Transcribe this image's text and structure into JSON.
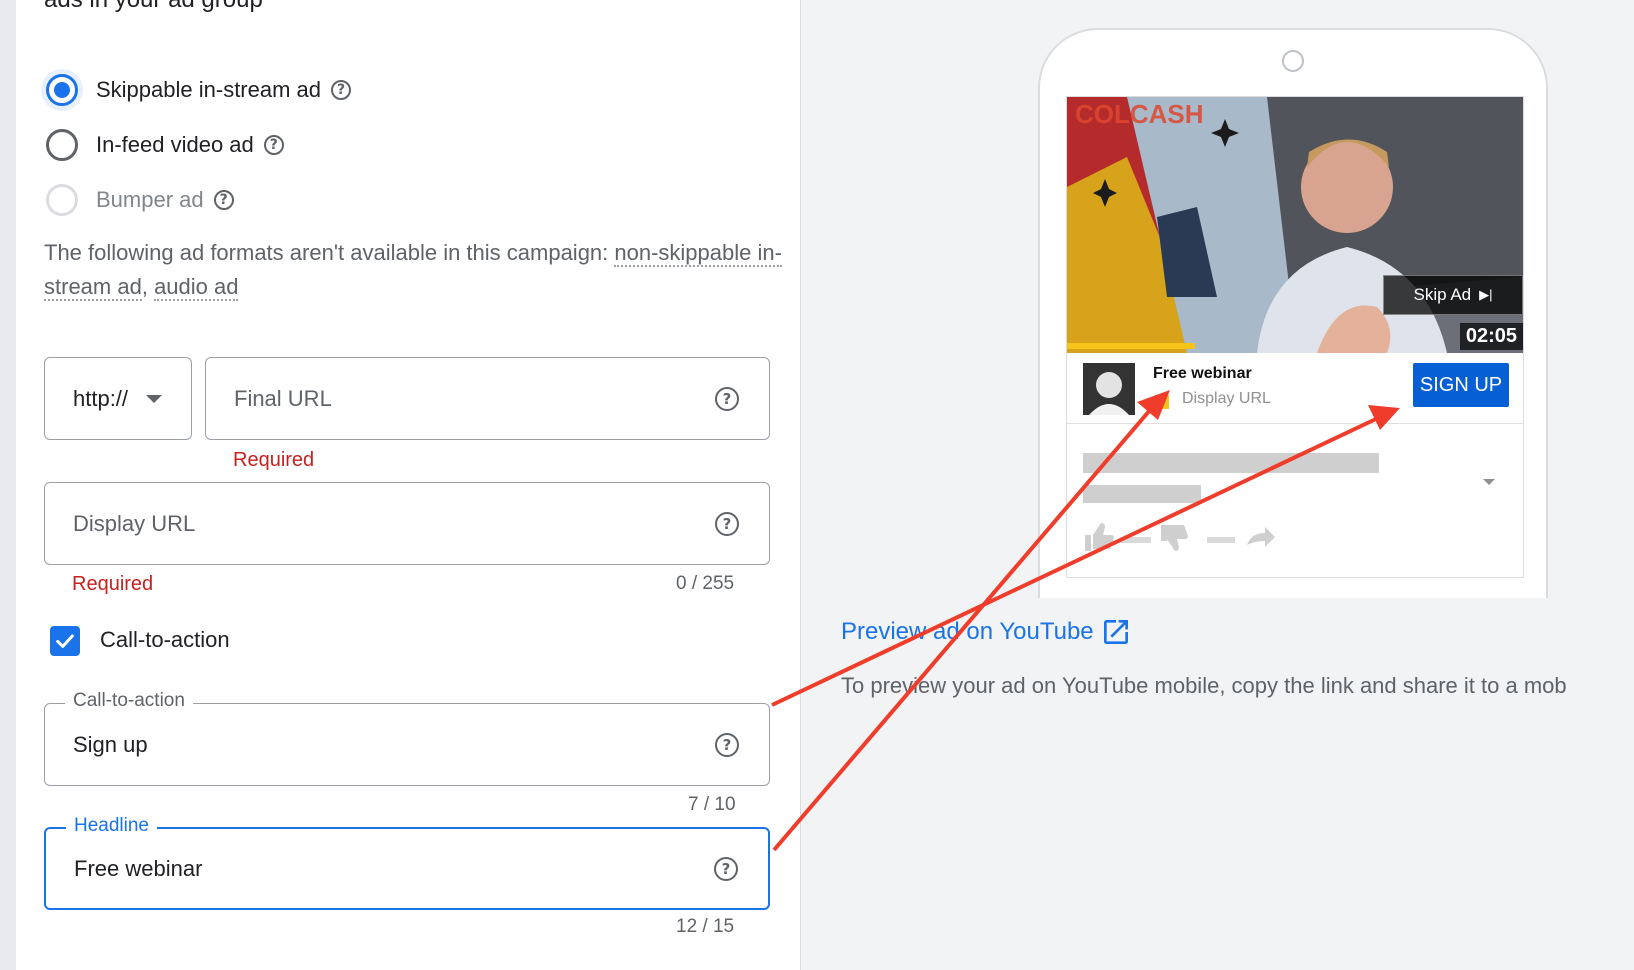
{
  "section": {
    "title": "ads in your ad group"
  },
  "ad_formats": [
    {
      "label": "Skippable in-stream ad",
      "selected": true,
      "disabled": false
    },
    {
      "label": "In-feed video ad",
      "selected": false,
      "disabled": false
    },
    {
      "label": "Bumper ad",
      "selected": false,
      "disabled": true
    }
  ],
  "unavailable_note": {
    "text": "The following ad formats aren't available in this campaign: ",
    "link1": "non-skippable in-stream ad",
    "separator": ", ",
    "link2": "audio ad"
  },
  "protocol_select": {
    "value": "http://"
  },
  "final_url": {
    "placeholder": "Final URL",
    "error": "Required"
  },
  "display_url": {
    "placeholder": "Display URL",
    "error": "Required",
    "counter": "0 / 255"
  },
  "cta_checkbox": {
    "label": "Call-to-action",
    "checked": true
  },
  "cta_field": {
    "label": "Call-to-action",
    "value": "Sign up",
    "counter": "7 / 10"
  },
  "headline_field": {
    "label": "Headline",
    "value": "Free webinar",
    "counter": "12 / 15"
  },
  "help_glyph": "?",
  "preview": {
    "brand_watermark": "COLCASH",
    "skip_label": "Skip Ad",
    "skip_icon": "▶|",
    "timer": "02:05",
    "headline": "Free webinar",
    "display_url": "Display URL",
    "cta_button": "SIGN UP",
    "video_progress": 0.28
  },
  "preview_link": {
    "label": "Preview ad on YouTube"
  },
  "preview_description": "To preview your ad on YouTube mobile, copy the link and share it to a mob",
  "colors": {
    "accent": "#1a73e8",
    "error": "#c5221f",
    "youtube_button": "#065fd4",
    "annotation_arrow": "#f03c2a"
  }
}
